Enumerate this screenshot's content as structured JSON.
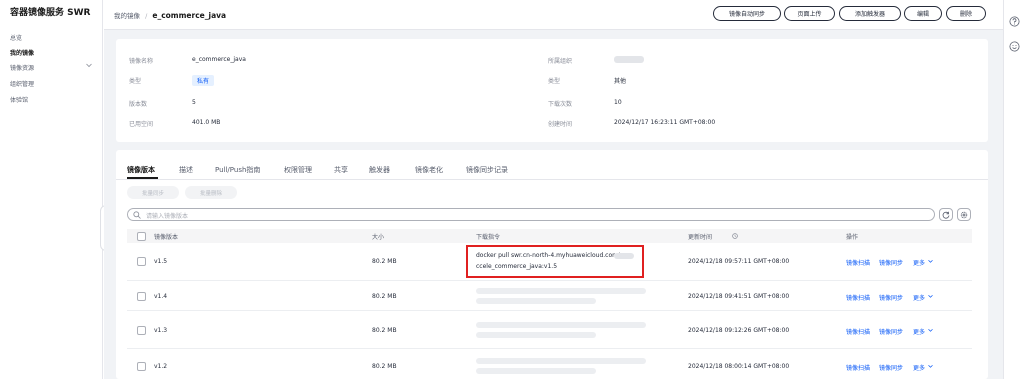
{
  "sidebar": {
    "title": "容器镜像服务 SWR",
    "items": [
      {
        "label": "总览"
      },
      {
        "label": "我的镜像"
      },
      {
        "label": "镜像资源"
      },
      {
        "label": "组织管理"
      },
      {
        "label": "体验馆"
      }
    ]
  },
  "header": {
    "breadcrumb_parent": "我的镜像",
    "separator": "/",
    "breadcrumb_current": "e_commerce_java",
    "buttons": [
      "镜像自动同步",
      "页面上传",
      "添加触发器",
      "编辑",
      "删除"
    ]
  },
  "info": {
    "name_label": "镜像名称",
    "name_value": "e_commerce_java",
    "type_label": "类型",
    "type_value": "私有",
    "versions_label": "版本数",
    "versions_value": "5",
    "size_label": "已用空间",
    "size_value": "401.0 MB",
    "org_label": "所属组织",
    "category_label": "类型",
    "category_value": "其他",
    "downloads_label": "下载次数",
    "downloads_value": "10",
    "created_label": "创建时间",
    "created_value": "2024/12/17 16:23:11 GMT+08:00"
  },
  "tabs": [
    "镜像版本",
    "描述",
    "Pull/Push指南",
    "权限管理",
    "共享",
    "触发器",
    "镜像老化",
    "镜像同步记录"
  ],
  "actions": {
    "sync": "批量同步",
    "delete": "批量删除"
  },
  "search": {
    "placeholder": "请输入镜像版本"
  },
  "table": {
    "headers": [
      "镜像版本",
      "大小",
      "下载指令",
      "更新时间",
      "操作"
    ],
    "rows": [
      {
        "version": "v1.5",
        "size": "80.2 MB",
        "cmd_line1": "docker pull swr.cn-north-4.myhuaweicloud.com/",
        "cmd_line2": "ccele_commerce_java:v1.5",
        "updated": "2024/12/18 09:57:11 GMT+08:00"
      },
      {
        "version": "v1.4",
        "size": "80.2 MB",
        "updated": "2024/12/18 09:41:51 GMT+08:00"
      },
      {
        "version": "v1.3",
        "size": "80.2 MB",
        "updated": "2024/12/18 09:12:26 GMT+08:00"
      },
      {
        "version": "v1.2",
        "size": "80.2 MB",
        "updated": "2024/12/18 08:00:14 GMT+08:00"
      }
    ],
    "ops": {
      "scan": "镜像扫描",
      "sync": "镜像同步",
      "more": "更多"
    }
  },
  "colors": {
    "accent": "#0a59f7",
    "highlight": "#e02020"
  }
}
